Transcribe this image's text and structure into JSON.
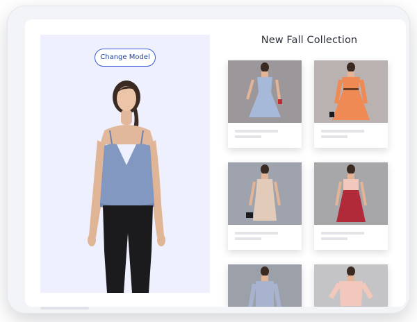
{
  "model_panel": {
    "change_model_label": "Change Model"
  },
  "collection": {
    "title": "New Fall Collection",
    "products": [
      {
        "dress_color": "#a7b9d8",
        "bg": "#9c979a"
      },
      {
        "dress_color": "#f08a55",
        "bg": "#b9b2b0"
      },
      {
        "dress_color": "#e3cbb9",
        "bg": "#9fa3ad"
      },
      {
        "dress_color": "#b02a3a",
        "bg": "#a7a7aa"
      },
      {
        "dress_color": "#a8b3d0",
        "bg": "#9ca0a8"
      },
      {
        "dress_color": "#f3c8bc",
        "bg": "#c4c3c6"
      }
    ]
  },
  "colors": {
    "accent": "#3b5bdb",
    "panel_bg": "#eef0fd",
    "tank_top": "#8398c0",
    "pants": "#1b1b1d"
  }
}
